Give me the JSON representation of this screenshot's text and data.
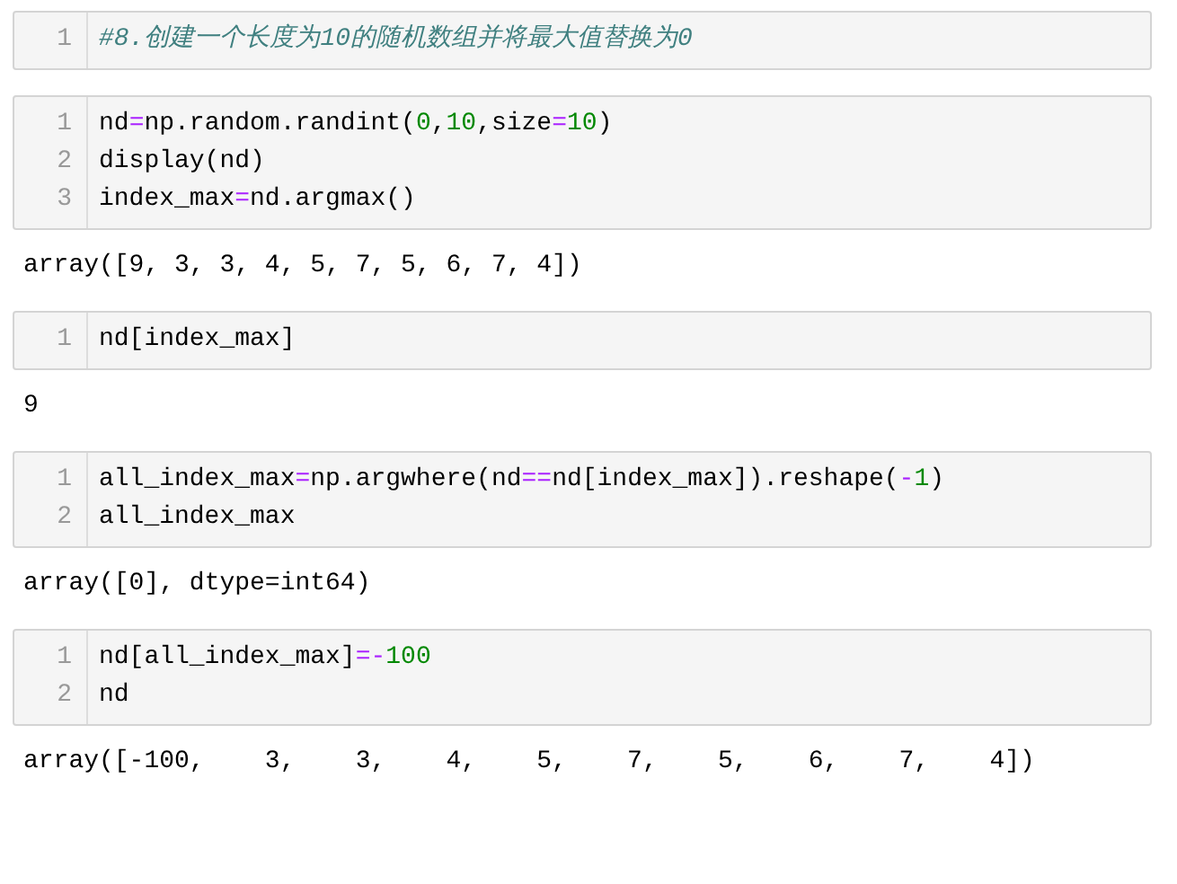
{
  "cells": [
    {
      "lines": [
        {
          "number": "1",
          "tokens": [
            {
              "kind": "comment",
              "text": "#8.创建一个长度为10的随机数组并将最大值替换为0"
            }
          ]
        }
      ]
    },
    {
      "lines": [
        {
          "number": "1",
          "tokens": [
            {
              "kind": "plain",
              "text": "nd"
            },
            {
              "kind": "op",
              "text": "="
            },
            {
              "kind": "plain",
              "text": "np.random.randint("
            },
            {
              "kind": "num",
              "text": "0"
            },
            {
              "kind": "plain",
              "text": ","
            },
            {
              "kind": "num",
              "text": "10"
            },
            {
              "kind": "plain",
              "text": ",size"
            },
            {
              "kind": "op",
              "text": "="
            },
            {
              "kind": "num",
              "text": "10"
            },
            {
              "kind": "plain",
              "text": ")"
            }
          ]
        },
        {
          "number": "2",
          "tokens": [
            {
              "kind": "plain",
              "text": "display(nd)"
            }
          ]
        },
        {
          "number": "3",
          "tokens": [
            {
              "kind": "plain",
              "text": "index_max"
            },
            {
              "kind": "op",
              "text": "="
            },
            {
              "kind": "plain",
              "text": "nd.argmax()"
            }
          ]
        }
      ],
      "output": "array([9, 3, 3, 4, 5, 7, 5, 6, 7, 4])"
    },
    {
      "lines": [
        {
          "number": "1",
          "tokens": [
            {
              "kind": "plain",
              "text": "nd[index_max]"
            }
          ]
        }
      ],
      "output": "9"
    },
    {
      "lines": [
        {
          "number": "1",
          "tokens": [
            {
              "kind": "plain",
              "text": "all_index_max"
            },
            {
              "kind": "op",
              "text": "="
            },
            {
              "kind": "plain",
              "text": "np.argwhere(nd"
            },
            {
              "kind": "op",
              "text": "=="
            },
            {
              "kind": "plain",
              "text": "nd[index_max]).reshape("
            },
            {
              "kind": "op",
              "text": "-"
            },
            {
              "kind": "num",
              "text": "1"
            },
            {
              "kind": "plain",
              "text": ")"
            }
          ]
        },
        {
          "number": "2",
          "tokens": [
            {
              "kind": "plain",
              "text": "all_index_max"
            }
          ]
        }
      ],
      "output": "array([0], dtype=int64)"
    },
    {
      "lines": [
        {
          "number": "1",
          "tokens": [
            {
              "kind": "plain",
              "text": "nd[all_index_max]"
            },
            {
              "kind": "op",
              "text": "=-"
            },
            {
              "kind": "num",
              "text": "100"
            }
          ]
        },
        {
          "number": "2",
          "tokens": [
            {
              "kind": "plain",
              "text": "nd"
            }
          ]
        }
      ],
      "output": "array([-100,    3,    3,    4,    5,    7,    5,    6,    7,    4])"
    }
  ]
}
